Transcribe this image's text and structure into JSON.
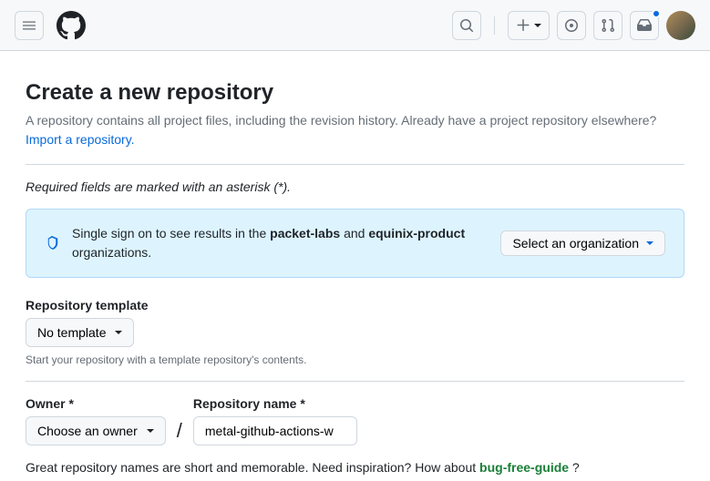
{
  "page": {
    "title": "Create a new repository",
    "subtitle_before": "A repository contains all project files, including the revision history. Already have a project repository elsewhere? ",
    "import_link": "Import a repository.",
    "required_note": "Required fields are marked with an asterisk (*)."
  },
  "sso": {
    "prefix": "Single sign on to see results in the ",
    "org1": "packet-labs",
    "mid": " and ",
    "org2": "equinix-product",
    "suffix": " organizations.",
    "button": "Select an organization"
  },
  "template": {
    "label": "Repository template",
    "value": "No template",
    "hint": "Start your repository with a template repository's contents."
  },
  "owner": {
    "label": "Owner *",
    "value": "Choose an owner"
  },
  "repo_name": {
    "label": "Repository name *",
    "value": "metal-github-actions-w"
  },
  "name_hint": {
    "text": "Great repository names are short and memorable. Need inspiration? How about ",
    "suggestion": "bug-free-guide",
    "qmark": " ?"
  }
}
